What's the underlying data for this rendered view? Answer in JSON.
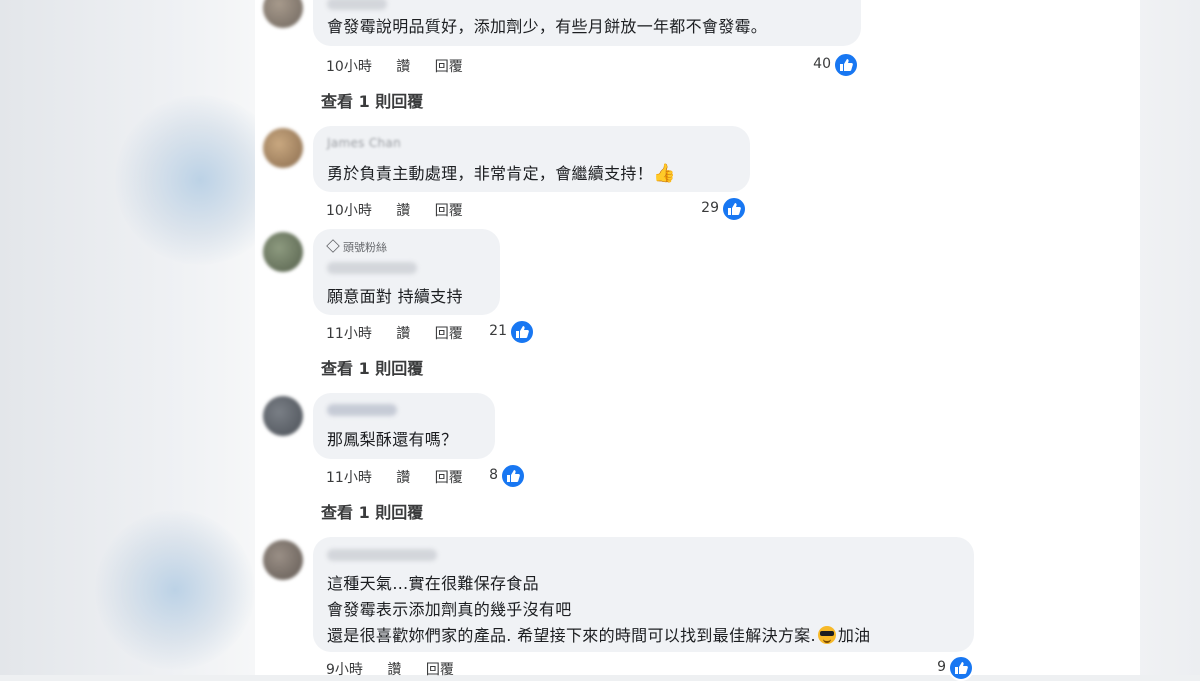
{
  "comments": [
    {
      "text": "會發霉說明品質好，添加劑少，有些月餅放一年都不會發霉。",
      "time": "10小時",
      "like_label": "讚",
      "reply_label": "回覆",
      "likes": "40",
      "view_replies": "查看 1 則回覆"
    },
    {
      "author": "James Chan",
      "text": "勇於負責主動處理，非常肯定，會繼續支持！",
      "time": "10小時",
      "like_label": "讚",
      "reply_label": "回覆",
      "likes": "29"
    },
    {
      "badge": "頭號粉絲",
      "text": "願意面對 持續支持",
      "time": "11小時",
      "like_label": "讚",
      "reply_label": "回覆",
      "likes": "21",
      "view_replies": "查看 1 則回覆"
    },
    {
      "text": "那鳳梨酥還有嗎？",
      "time": "11小時",
      "like_label": "讚",
      "reply_label": "回覆",
      "likes": "8",
      "view_replies": "查看 1 則回覆"
    },
    {
      "line1": "這種天氣…實在很難保存食品",
      "line2": "會發霉表示添加劑真的幾乎沒有吧",
      "line3": "還是很喜歡妳們家的產品. 希望接下來的時間可以找到最佳解決方案.",
      "line3_end": "加油",
      "time": "9小時",
      "like_label": "讚",
      "reply_label": "回覆",
      "likes": "9"
    }
  ],
  "colors": {
    "like_blue": "#1877f2",
    "bubble": "#f0f2f5"
  }
}
